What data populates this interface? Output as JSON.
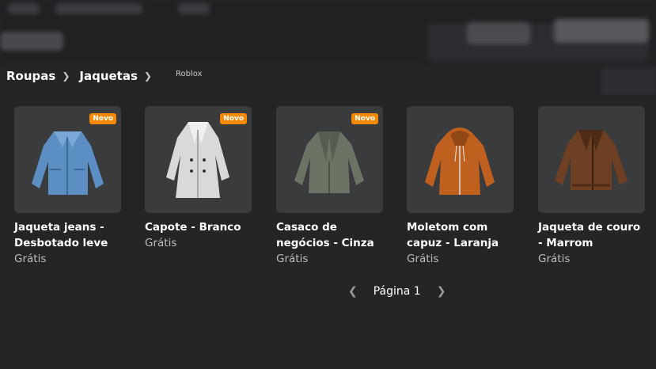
{
  "breadcrumb": {
    "items": [
      "Roupas",
      "Jaquetas"
    ],
    "creator": "Roblox"
  },
  "items": [
    {
      "title_line1": "Jaqueta jeans -",
      "title_line2": "Desbotado leve",
      "price": "Grátis",
      "badge": "Novo",
      "color": "#5b8fc4"
    },
    {
      "title_line1": "Capote - Branco",
      "title_line2": "",
      "price": "Grátis",
      "badge": "Novo",
      "color": "#d9d9d9"
    },
    {
      "title_line1": "Casaco de",
      "title_line2": "negócios - Cinza",
      "price": "Grátis",
      "badge": "Novo",
      "color": "#6b7364"
    },
    {
      "title_line1": "Moletom com",
      "title_line2": "capuz - Laranja",
      "price": "Grátis",
      "badge": "",
      "color": "#c0601f"
    },
    {
      "title_line1": "Jaqueta de couro",
      "title_line2": "- Marrom",
      "price": "Grátis",
      "badge": "",
      "color": "#6e3f22"
    }
  ],
  "pagination": {
    "label": "Página 1",
    "prev_icon": "chevron-left-icon",
    "next_icon": "chevron-right-icon"
  }
}
